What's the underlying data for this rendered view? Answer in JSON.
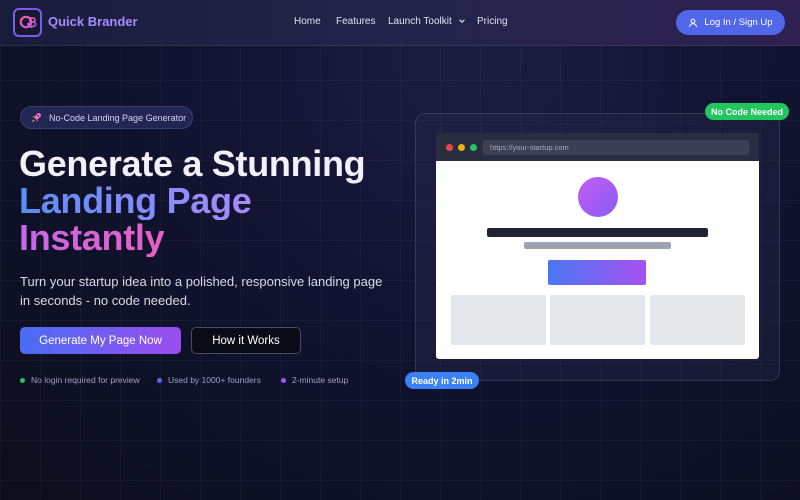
{
  "brand": {
    "name": "Quick Brander",
    "logo_icon": "qb-monogram-icon",
    "logo_text": "QB"
  },
  "nav": {
    "items": [
      {
        "label": "Home"
      },
      {
        "label": "Features"
      },
      {
        "label": "Launch Toolkit",
        "has_dropdown": true
      },
      {
        "label": "Pricing"
      }
    ],
    "login_label": "Log In / Sign Up",
    "login_icon": "user-icon"
  },
  "hero": {
    "pill_icon": "rocket-icon",
    "pill_label": "No-Code Landing Page Generator",
    "headline_1": "Generate a Stunning",
    "headline_2": "Landing Page",
    "headline_3": "Instantly",
    "subtitle": "Turn your startup idea into a polished, responsive landing page in seconds - no code needed.",
    "primary_cta": "Generate My Page Now",
    "secondary_cta": "How it Works",
    "features": [
      {
        "label": "No login required for preview",
        "color": "#22c55e"
      },
      {
        "label": "Used by 1000+ founders",
        "color": "#6366f1"
      },
      {
        "label": "2-minute setup",
        "color": "#a855f7"
      }
    ]
  },
  "preview": {
    "url": "https://your-startup.com",
    "badge_top": "No Code Needed",
    "badge_bottom": "Ready in 2min",
    "window_dots": [
      "#ef4444",
      "#eab308",
      "#22c55e"
    ]
  },
  "colors": {
    "accent": "#4f67e8",
    "brand": "#a58cff",
    "success": "#22c55e",
    "info": "#3b82f6"
  }
}
